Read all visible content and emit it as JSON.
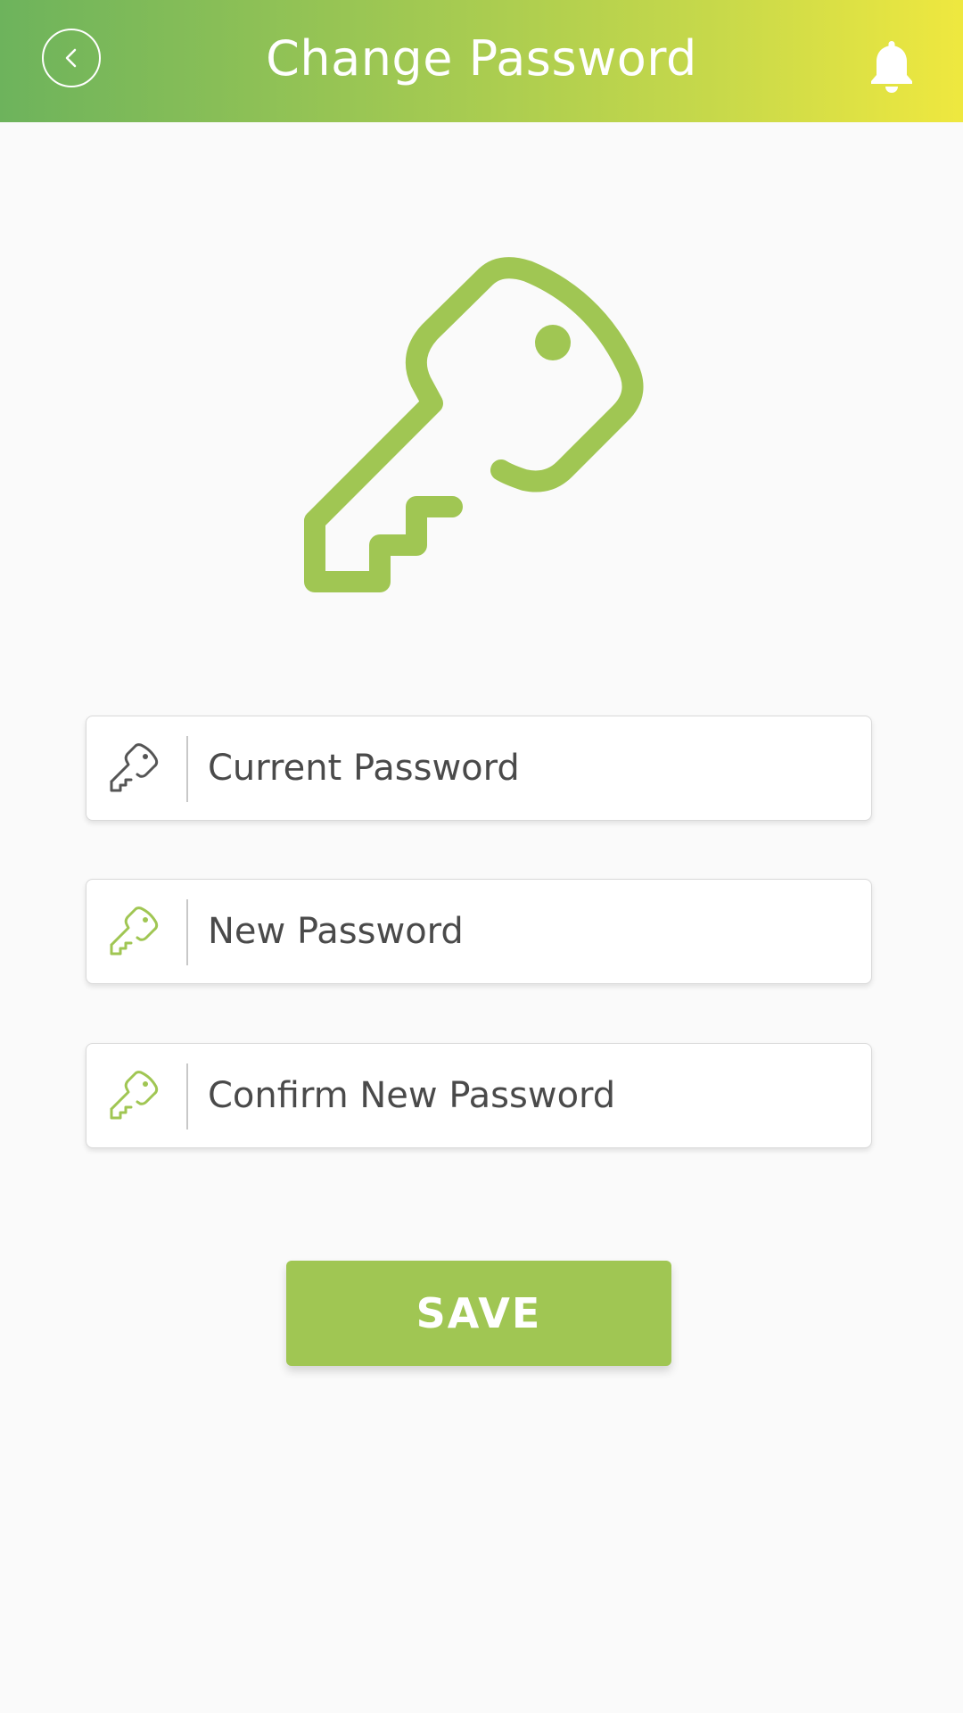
{
  "header": {
    "title": "Change Password",
    "back_icon": "chevron-left-icon",
    "notification_icon": "bell-icon"
  },
  "hero": {
    "icon": "key-icon"
  },
  "form": {
    "fields": [
      {
        "placeholder": "Current Password",
        "value": "",
        "icon": "key-icon",
        "icon_color": "#555555"
      },
      {
        "placeholder": "New Password",
        "value": "",
        "icon": "key-icon",
        "icon_color": "#a0c653"
      },
      {
        "placeholder": "Confirm New Password",
        "value": "",
        "icon": "key-icon",
        "icon_color": "#a0c653"
      }
    ]
  },
  "actions": {
    "save_label": "SAVE"
  },
  "colors": {
    "accent": "#a0c653",
    "header_gradient_start": "#6db35c",
    "header_gradient_end": "#efe83f",
    "text": "#4a4a4a",
    "background": "#fafafa"
  }
}
